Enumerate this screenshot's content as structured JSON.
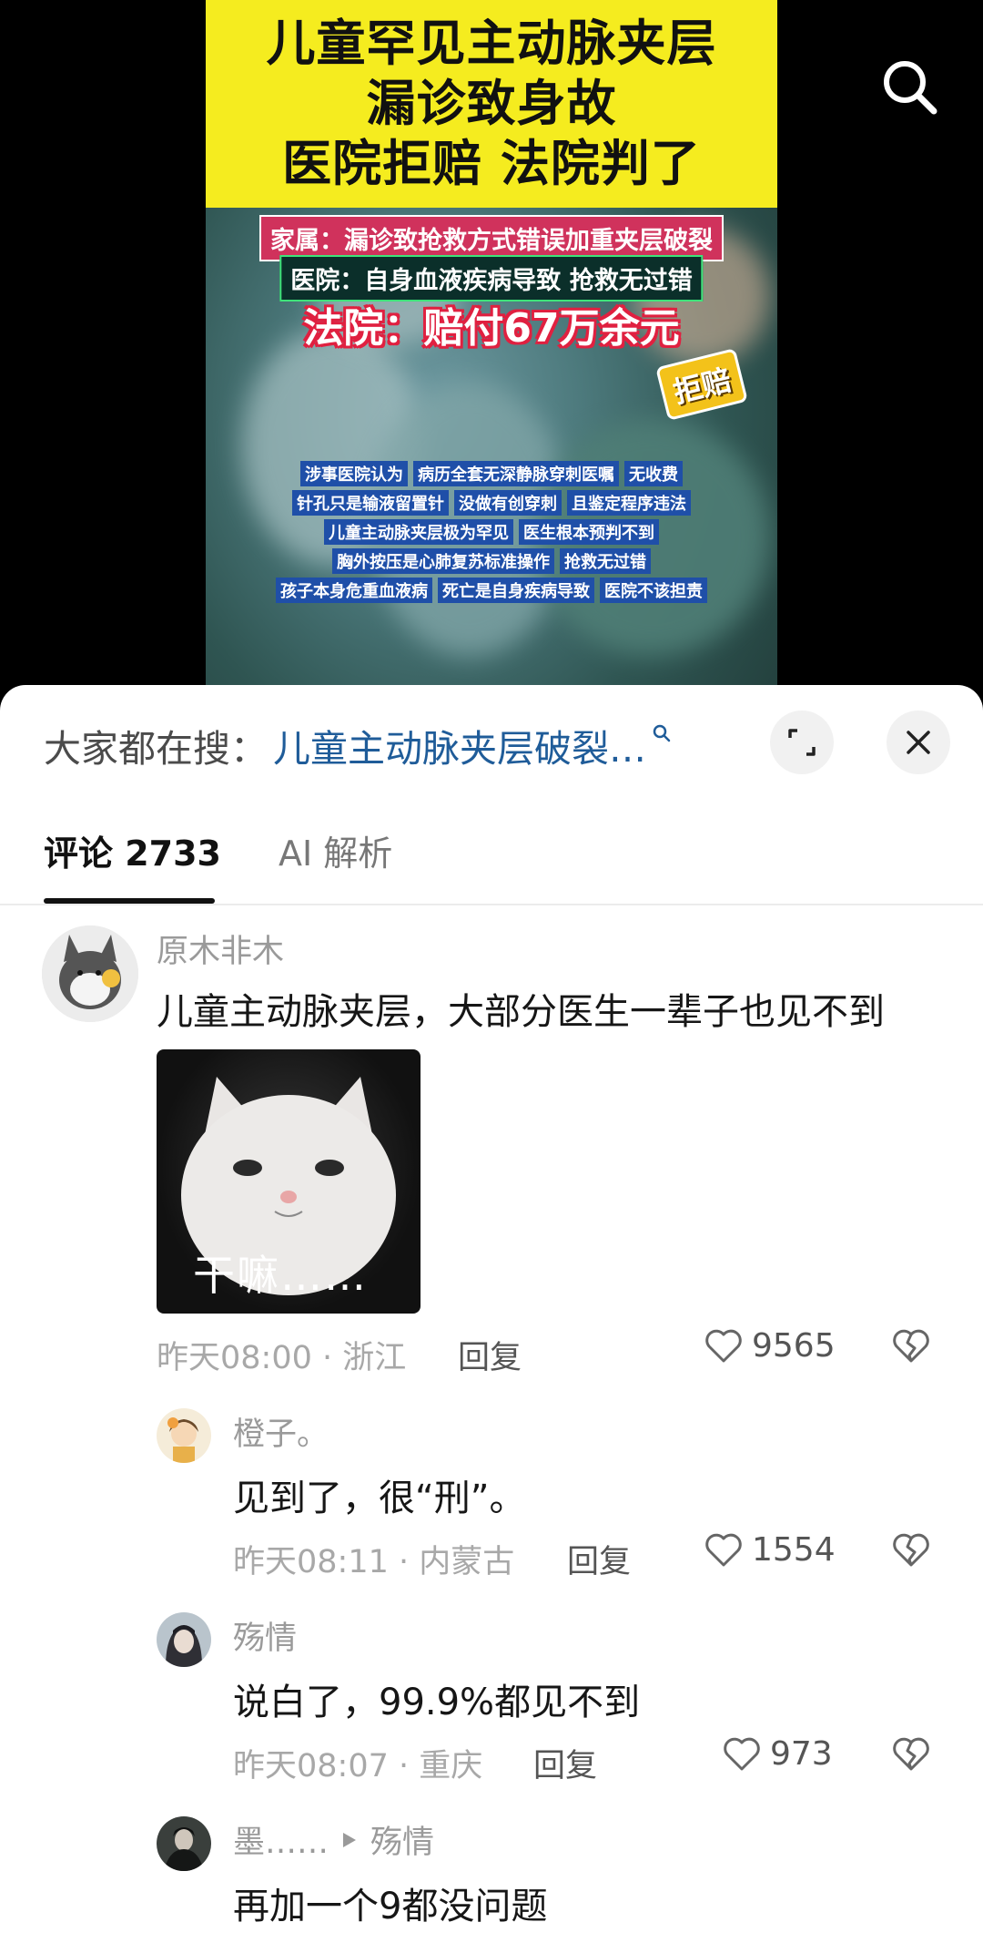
{
  "video": {
    "headline": [
      "儿童罕见主动脉夹层",
      "漏诊致身故",
      "医院拒赔 法院判了"
    ],
    "tag_family": "家属：漏诊致抢救方式错误加重夹层破裂",
    "tag_hospital": "医院：自身血液疾病导致 抢救无过错",
    "tag_court": "法院：赔付67万余元",
    "badge": "拒赔",
    "captions": [
      [
        "涉事医院认为",
        "病历全套无深静脉穿刺医嘱",
        "无收费"
      ],
      [
        "针孔只是输液留置针",
        "没做有创穿刺",
        "且鉴定程序违法"
      ],
      [
        "儿童主动脉夹层极为罕见",
        "医生根本预判不到"
      ],
      [
        "胸外按压是心肺复苏标准操作",
        "抢救无过错"
      ],
      [
        "孩子本身危重血液病",
        "死亡是自身疾病导致",
        "医院不该担责"
      ]
    ]
  },
  "search": {
    "prefix": "大家都在搜：",
    "term": "儿童主动脉夹层破裂…"
  },
  "tabs": {
    "comments": "评论 2733",
    "ai": "AI 解析"
  },
  "comments": [
    {
      "user": "原木非木",
      "text": "儿童主动脉夹层，大部分医生一辈子也见不到",
      "meme_text": "干嘛……",
      "time": "昨天08:00 · 浙江",
      "reply": "回复",
      "likes": "9565"
    },
    {
      "user": "橙子。",
      "text": "见到了，很“刑”。",
      "time": "昨天08:11 · 内蒙古",
      "reply": "回复",
      "likes": "1554"
    },
    {
      "user": "殇情",
      "text": "说白了，99.9%都见不到",
      "time": "昨天08:07 · 重庆",
      "reply": "回复",
      "likes": "973"
    },
    {
      "user": "墨……",
      "reply_to": "殇情",
      "text": "再加一个9都没问题"
    }
  ],
  "icons": {
    "search": "search-icon",
    "expand": "expand-icon",
    "close": "close-icon",
    "like": "heart-outline-icon",
    "dislike": "broken-heart-icon"
  },
  "colors": {
    "search_term": "#1f5c99",
    "header_yellow": "#f5ec1f"
  }
}
